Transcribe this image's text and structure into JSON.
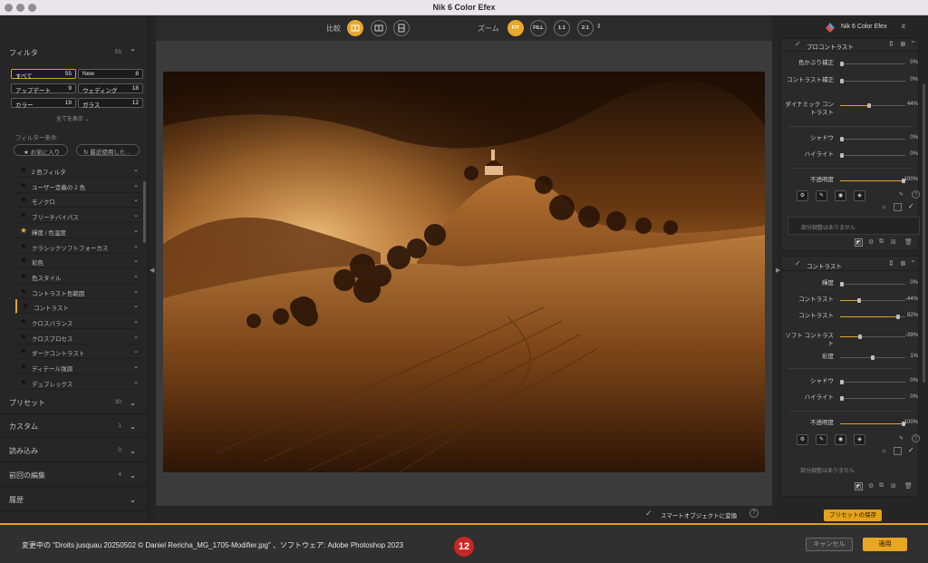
{
  "window": {
    "title": "Nik 6 Color Efex"
  },
  "left": {
    "filter_label": "フィルタ",
    "filter_count": "55",
    "buttons": [
      {
        "name": "すべて",
        "count": "55"
      },
      {
        "name": "New",
        "count": "8"
      },
      {
        "name": "アップデート",
        "count": "9"
      },
      {
        "name": "ウェディング",
        "count": "18"
      },
      {
        "name": "カラー",
        "count": "19"
      },
      {
        "name": "ガラス",
        "count": "12"
      }
    ],
    "show_all": "全てを表示",
    "conditions_label": "フィルター条件:",
    "favorites": "お気に入り",
    "recent": "最近使用した…",
    "filters": [
      "2 色フィルタ",
      "ユーザー定義の 2 色",
      "モノクロ",
      "ブリーチバイパス",
      "輝度 / 色温度",
      "クラシックソフトフォーカス",
      "彩色",
      "色スタイル",
      "コントラスト色範囲",
      "コントラスト",
      "クロスバランス",
      "クロスプロセス",
      "ダークコントラスト",
      "ディテール強調",
      "デュプレックス"
    ],
    "sections": [
      {
        "label": "プリセット",
        "count": "30"
      },
      {
        "label": "カスタム",
        "count": "1"
      },
      {
        "label": "読み込み",
        "count": "0"
      },
      {
        "label": "前回の編集",
        "count": "4"
      },
      {
        "label": "履歴",
        "count": ""
      }
    ]
  },
  "toolbar": {
    "compare_label": "比較",
    "zoom_label": "ズーム",
    "zoom_fit": "FIT",
    "zoom_fill": "FILL",
    "zoom_1_1": "1:1",
    "zoom_2_1": "2:1"
  },
  "bottom": {
    "smart_object": "スマートオブジェクトに変換"
  },
  "right": {
    "brand": "Nik 6 Color Efex",
    "panel1": {
      "title": "プロコントラスト",
      "sliders": [
        {
          "label": "色かぶり補正",
          "value": "0%"
        },
        {
          "label": "コントラスト補正",
          "value": "0%"
        },
        {
          "label": "ダイナミック コントラスト",
          "value": "44%"
        }
      ],
      "shadows": {
        "label": "シャドウ",
        "value": "0%"
      },
      "highlights": {
        "label": "ハイライト",
        "value": "0%"
      },
      "opacity": {
        "label": "不透明度",
        "value": "100%"
      },
      "no_mask": "部分調整はありません"
    },
    "panel2": {
      "title": "コントラスト",
      "sliders": [
        {
          "label": "輝度",
          "value": "0%"
        },
        {
          "label": "コントラスト",
          "value": "-44%"
        },
        {
          "label": "コントラスト",
          "value": "82%"
        },
        {
          "label": "ソフト コントラスト",
          "value": "-39%"
        },
        {
          "label": "彩度",
          "value": "1%"
        }
      ],
      "shadows": {
        "label": "シャドウ",
        "value": "0%"
      },
      "highlights": {
        "label": "ハイライト",
        "value": "0%"
      },
      "opacity": {
        "label": "不透明度",
        "value": "100%"
      },
      "no_mask": "部分調整はありません"
    },
    "save_preset": "プリセットの保存"
  },
  "footer": {
    "status": "変更中の \"Droits jusquau 20250502 © Daniel Rericha_MG_1705-Modifier.jpg\" 、ソフトウェア: Adobe Photoshop 2023",
    "badge": "12",
    "cancel": "キャンセル",
    "apply": "適用"
  },
  "colors": {
    "accent": "#e9a622",
    "badge": "#c92626"
  }
}
